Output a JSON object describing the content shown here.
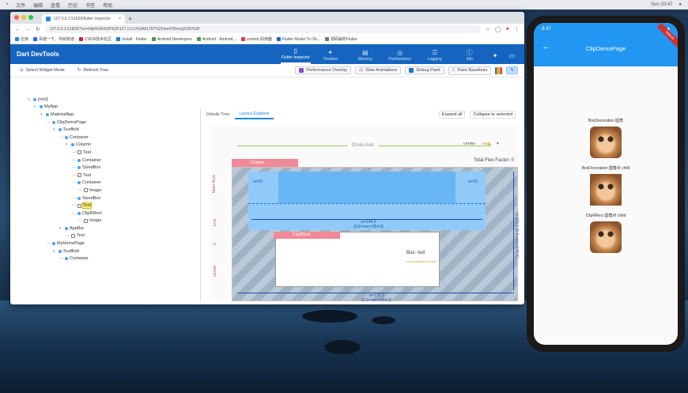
{
  "menubar": {
    "left": [
      "•",
      "文件",
      "编辑",
      "查看",
      "历史",
      "书签",
      "帮助"
    ],
    "right": [
      "Sun 20:47",
      "●"
    ]
  },
  "browser": {
    "tab_label": "127.0.0.1:51826/flutter Inspector",
    "tab_close": "×",
    "new_tab": "+",
    "url": "127.0.0.1:51826/?uri=http%3A%2F%2F127.0.0.1%3A51787%2Fwe4YBmcg%3D%2F",
    "nav_back": "←",
    "nav_forward": "→",
    "nav_reload": "↻",
    "bookmarks": [
      "应用",
      "百度一下，你就知道",
      "CSDN技术社区",
      "Install - Flutter",
      "Android Developers",
      "Android - Android...",
      "comixd 阅读器",
      "Flutter Model To Ob...",
      "源码解析Flutter"
    ]
  },
  "devtools": {
    "title": "Dart DevTools",
    "nav": [
      {
        "glyph": "▯",
        "label": "Flutter Inspector"
      },
      {
        "glyph": "✦",
        "label": "Timeline"
      },
      {
        "glyph": "▤",
        "label": "Memory"
      },
      {
        "glyph": "◎",
        "label": "Performance"
      },
      {
        "glyph": "☰",
        "label": "Logging"
      },
      {
        "glyph": "ⓘ",
        "label": "Info"
      }
    ],
    "toolbar": {
      "select_widget": "Select Widget Mode",
      "refresh_tree": "Refresh Tree",
      "performance_overlay": "Performance Overlay",
      "show_animations": "Slow Animations",
      "debug_paint": "Debug Paint",
      "paint_baselines": "Paint Baselines"
    },
    "tree": [
      {
        "d": 0,
        "t": "[root]",
        "k": "dot"
      },
      {
        "d": 1,
        "t": "MyApp",
        "k": "dot"
      },
      {
        "d": 2,
        "t": "MaterialApp",
        "k": "dot"
      },
      {
        "d": 3,
        "t": "ClipDemoPage",
        "k": "dot"
      },
      {
        "d": 4,
        "t": "Scaffold",
        "k": "dot"
      },
      {
        "d": 5,
        "t": "Container",
        "k": "dot"
      },
      {
        "d": 6,
        "t": "Column",
        "k": "dot"
      },
      {
        "d": 7,
        "t": "Text",
        "k": "sq"
      },
      {
        "d": 7,
        "t": "Container",
        "k": "dot"
      },
      {
        "d": 7,
        "t": "SizedBox",
        "k": "dot"
      },
      {
        "d": 7,
        "t": "Text",
        "k": "sq"
      },
      {
        "d": 7,
        "t": "Container",
        "k": "dot"
      },
      {
        "d": 8,
        "t": "Image",
        "k": "sq"
      },
      {
        "d": 7,
        "t": "SizedBox",
        "k": "dot"
      },
      {
        "d": 7,
        "t": "Text",
        "k": "sq",
        "sel": true
      },
      {
        "d": 7,
        "t": "ClipRRect",
        "k": "dot"
      },
      {
        "d": 8,
        "t": "Image",
        "k": "sq"
      },
      {
        "d": 5,
        "t": "AppBar",
        "k": "dot"
      },
      {
        "d": 6,
        "t": "Text",
        "k": "sq"
      },
      {
        "d": 3,
        "t": "MyHomePage",
        "k": "dot"
      },
      {
        "d": 4,
        "t": "Scaffold",
        "k": "dot"
      },
      {
        "d": 5,
        "t": "Container",
        "k": "dot"
      }
    ],
    "panel": {
      "tab_details": "Details Tree",
      "tab_layout": "Layout Explorer",
      "expand_all": "Expand all",
      "collapse": "Collapse to selected",
      "cross_axis": "Cross Axis",
      "main_axis": "Main Axis",
      "align": "center",
      "align_right": "start",
      "total_flex": "Total Flex Factor: 0",
      "child1_label": "Column",
      "child2_label": "ClipRRect",
      "dim_w1": "w=144.0",
      "dim_w1b": "(0.0<=w<=354.0)",
      "dim_w2": "w=176.0",
      "dim_w2b": "(0.0<=w<=264.0)",
      "dim_left": "w=10",
      "dim_right": "w=10",
      "dim_h": "h=176.0",
      "dim_hb": "(0.0<=h<=176.0)",
      "box_text": "Box: null",
      "box_sub": "unconstrained default",
      "side_center": "center",
      "side_mid": "Π",
      "side_start": "end"
    }
  },
  "phone": {
    "time": "8:47",
    "wifi": "◉ ▮",
    "back": "←",
    "title": "ClipDemoPage",
    "debug_banner": "DEBUG",
    "items": [
      {
        "label": "BoxDecoration 圆角",
        "clip": false
      },
      {
        "label": "BoxDecoration 圆角对 child",
        "clip": true
      },
      {
        "label": "ClipRRect 圆角对 child",
        "clip": false
      }
    ]
  }
}
